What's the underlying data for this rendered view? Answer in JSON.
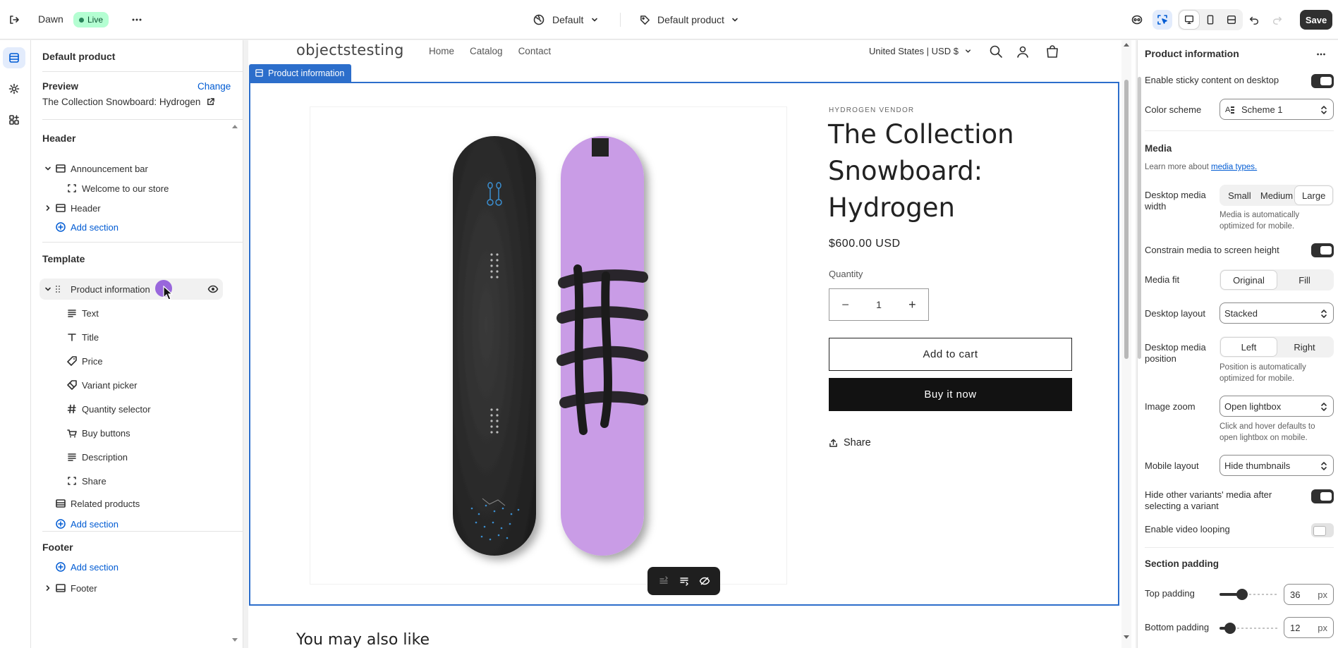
{
  "topbar": {
    "theme_name": "Dawn",
    "live_badge": "Live",
    "market_select": "Default",
    "template_select": "Default product",
    "save_label": "Save"
  },
  "left_panel": {
    "title": "Default product",
    "preview_label": "Preview",
    "change_link": "Change",
    "preview_product": "The Collection Snowboard: Hydrogen",
    "header_group": "Header",
    "announcement_bar": "Announcement bar",
    "welcome_block": "Welcome to our store",
    "header_section": "Header",
    "add_section": "Add section",
    "template_group": "Template",
    "product_information": "Product information",
    "blocks": [
      "Text",
      "Title",
      "Price",
      "Variant picker",
      "Quantity selector",
      "Buy buttons",
      "Description",
      "Share"
    ],
    "related_products": "Related products",
    "footer_group": "Footer",
    "footer_section": "Footer"
  },
  "preview": {
    "store_name": "objectstesting",
    "nav": [
      "Home",
      "Catalog",
      "Contact"
    ],
    "locale": "United States | USD $",
    "section_tag": "Product information",
    "vendor": "HYDROGEN VENDOR",
    "product_title": "The Collection Snowboard: Hydrogen",
    "price": "$600.00 USD",
    "quantity_label": "Quantity",
    "quantity_value": "1",
    "add_to_cart": "Add to cart",
    "buy_now": "Buy it now",
    "share": "Share",
    "related_heading": "You may also like"
  },
  "right_panel": {
    "title": "Product information",
    "sticky_label": "Enable sticky content on desktop",
    "sticky_on": true,
    "color_scheme_label": "Color scheme",
    "color_scheme_value": "Scheme 1",
    "media_heading": "Media",
    "learn_more": "Learn more about",
    "media_types_link": "media types.",
    "desktop_media_width_label": "Desktop media width",
    "media_width_options": [
      "Small",
      "Medium",
      "Large"
    ],
    "media_width_selected": "Large",
    "media_width_help": "Media is automatically optimized for mobile.",
    "constrain_label": "Constrain media to screen height",
    "constrain_on": true,
    "media_fit_label": "Media fit",
    "media_fit_options": [
      "Original",
      "Fill"
    ],
    "media_fit_selected": "Original",
    "desktop_layout_label": "Desktop layout",
    "desktop_layout_value": "Stacked",
    "media_position_label": "Desktop media position",
    "media_position_options": [
      "Left",
      "Right"
    ],
    "media_position_selected": "Left",
    "media_position_help": "Position is automatically optimized for mobile.",
    "image_zoom_label": "Image zoom",
    "image_zoom_value": "Open lightbox",
    "image_zoom_help": "Click and hover defaults to open lightbox on mobile.",
    "mobile_layout_label": "Mobile layout",
    "mobile_layout_value": "Hide thumbnails",
    "hide_variants_label": "Hide other variants' media after selecting a variant",
    "hide_variants_on": true,
    "video_loop_label": "Enable video looping",
    "video_loop_on": false,
    "padding_heading": "Section padding",
    "top_padding_label": "Top padding",
    "top_padding_value": "36",
    "bottom_padding_label": "Bottom padding",
    "bottom_padding_value": "12",
    "px_unit": "px"
  },
  "colors": {
    "accent": "#005bd3",
    "selection": "#2c6ecb",
    "live_badge_bg": "#b4fed2",
    "board_purple": "#c99ce6",
    "board_dark": "#2b2b2b",
    "cursor_dot": "#8a4fd8"
  }
}
